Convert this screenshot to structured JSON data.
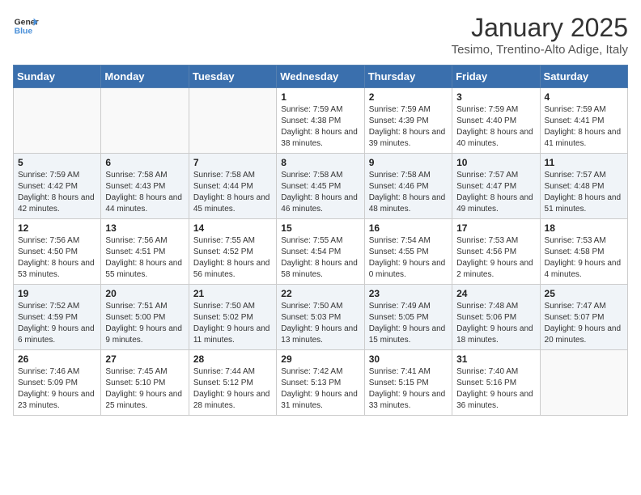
{
  "header": {
    "logo_line1": "General",
    "logo_line2": "Blue",
    "title": "January 2025",
    "subtitle": "Tesimo, Trentino-Alto Adige, Italy"
  },
  "weekdays": [
    "Sunday",
    "Monday",
    "Tuesday",
    "Wednesday",
    "Thursday",
    "Friday",
    "Saturday"
  ],
  "weeks": [
    [
      {
        "day": "",
        "info": ""
      },
      {
        "day": "",
        "info": ""
      },
      {
        "day": "",
        "info": ""
      },
      {
        "day": "1",
        "info": "Sunrise: 7:59 AM\nSunset: 4:38 PM\nDaylight: 8 hours and 38 minutes."
      },
      {
        "day": "2",
        "info": "Sunrise: 7:59 AM\nSunset: 4:39 PM\nDaylight: 8 hours and 39 minutes."
      },
      {
        "day": "3",
        "info": "Sunrise: 7:59 AM\nSunset: 4:40 PM\nDaylight: 8 hours and 40 minutes."
      },
      {
        "day": "4",
        "info": "Sunrise: 7:59 AM\nSunset: 4:41 PM\nDaylight: 8 hours and 41 minutes."
      }
    ],
    [
      {
        "day": "5",
        "info": "Sunrise: 7:59 AM\nSunset: 4:42 PM\nDaylight: 8 hours and 42 minutes."
      },
      {
        "day": "6",
        "info": "Sunrise: 7:58 AM\nSunset: 4:43 PM\nDaylight: 8 hours and 44 minutes."
      },
      {
        "day": "7",
        "info": "Sunrise: 7:58 AM\nSunset: 4:44 PM\nDaylight: 8 hours and 45 minutes."
      },
      {
        "day": "8",
        "info": "Sunrise: 7:58 AM\nSunset: 4:45 PM\nDaylight: 8 hours and 46 minutes."
      },
      {
        "day": "9",
        "info": "Sunrise: 7:58 AM\nSunset: 4:46 PM\nDaylight: 8 hours and 48 minutes."
      },
      {
        "day": "10",
        "info": "Sunrise: 7:57 AM\nSunset: 4:47 PM\nDaylight: 8 hours and 49 minutes."
      },
      {
        "day": "11",
        "info": "Sunrise: 7:57 AM\nSunset: 4:48 PM\nDaylight: 8 hours and 51 minutes."
      }
    ],
    [
      {
        "day": "12",
        "info": "Sunrise: 7:56 AM\nSunset: 4:50 PM\nDaylight: 8 hours and 53 minutes."
      },
      {
        "day": "13",
        "info": "Sunrise: 7:56 AM\nSunset: 4:51 PM\nDaylight: 8 hours and 55 minutes."
      },
      {
        "day": "14",
        "info": "Sunrise: 7:55 AM\nSunset: 4:52 PM\nDaylight: 8 hours and 56 minutes."
      },
      {
        "day": "15",
        "info": "Sunrise: 7:55 AM\nSunset: 4:54 PM\nDaylight: 8 hours and 58 minutes."
      },
      {
        "day": "16",
        "info": "Sunrise: 7:54 AM\nSunset: 4:55 PM\nDaylight: 9 hours and 0 minutes."
      },
      {
        "day": "17",
        "info": "Sunrise: 7:53 AM\nSunset: 4:56 PM\nDaylight: 9 hours and 2 minutes."
      },
      {
        "day": "18",
        "info": "Sunrise: 7:53 AM\nSunset: 4:58 PM\nDaylight: 9 hours and 4 minutes."
      }
    ],
    [
      {
        "day": "19",
        "info": "Sunrise: 7:52 AM\nSunset: 4:59 PM\nDaylight: 9 hours and 6 minutes."
      },
      {
        "day": "20",
        "info": "Sunrise: 7:51 AM\nSunset: 5:00 PM\nDaylight: 9 hours and 9 minutes."
      },
      {
        "day": "21",
        "info": "Sunrise: 7:50 AM\nSunset: 5:02 PM\nDaylight: 9 hours and 11 minutes."
      },
      {
        "day": "22",
        "info": "Sunrise: 7:50 AM\nSunset: 5:03 PM\nDaylight: 9 hours and 13 minutes."
      },
      {
        "day": "23",
        "info": "Sunrise: 7:49 AM\nSunset: 5:05 PM\nDaylight: 9 hours and 15 minutes."
      },
      {
        "day": "24",
        "info": "Sunrise: 7:48 AM\nSunset: 5:06 PM\nDaylight: 9 hours and 18 minutes."
      },
      {
        "day": "25",
        "info": "Sunrise: 7:47 AM\nSunset: 5:07 PM\nDaylight: 9 hours and 20 minutes."
      }
    ],
    [
      {
        "day": "26",
        "info": "Sunrise: 7:46 AM\nSunset: 5:09 PM\nDaylight: 9 hours and 23 minutes."
      },
      {
        "day": "27",
        "info": "Sunrise: 7:45 AM\nSunset: 5:10 PM\nDaylight: 9 hours and 25 minutes."
      },
      {
        "day": "28",
        "info": "Sunrise: 7:44 AM\nSunset: 5:12 PM\nDaylight: 9 hours and 28 minutes."
      },
      {
        "day": "29",
        "info": "Sunrise: 7:42 AM\nSunset: 5:13 PM\nDaylight: 9 hours and 31 minutes."
      },
      {
        "day": "30",
        "info": "Sunrise: 7:41 AM\nSunset: 5:15 PM\nDaylight: 9 hours and 33 minutes."
      },
      {
        "day": "31",
        "info": "Sunrise: 7:40 AM\nSunset: 5:16 PM\nDaylight: 9 hours and 36 minutes."
      },
      {
        "day": "",
        "info": ""
      }
    ]
  ]
}
